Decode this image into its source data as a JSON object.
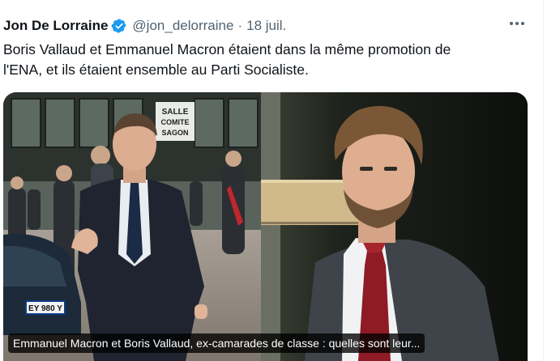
{
  "tweet": {
    "author_name": "Jon De Lorraine",
    "handle": "@jon_delorraine",
    "separator": "·",
    "date": "18 juil.",
    "text_lines": [
      "Boris Vallaud et Emmanuel Macron étaient dans la même promotion de",
      "l'ENA, et ils étaient ensemble au Parti Socialiste."
    ],
    "verified_icon": "verified-badge-icon",
    "more_icon": "more-horizontal-icon"
  },
  "card": {
    "caption": "Emmanuel Macron et Boris Vallaud, ex-camarades de classe : quelles sont leur...",
    "sign_text": [
      "SALLE",
      "COMITE",
      "SAGON"
    ],
    "plate_text": "EY 980 Y"
  },
  "colors": {
    "verified": "#1d9bf0",
    "text": "#0f1419",
    "muted": "#536471"
  }
}
